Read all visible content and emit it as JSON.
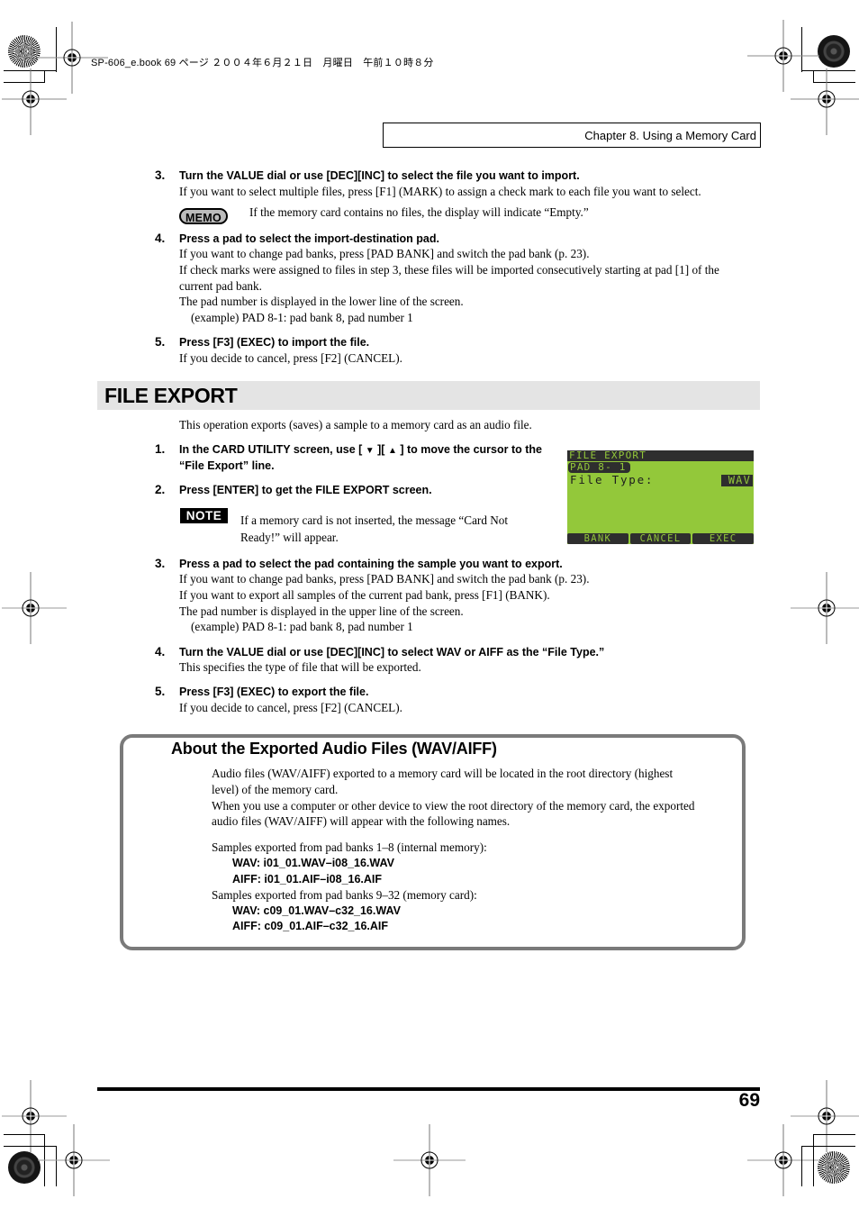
{
  "print_header": {
    "meta_line": "SP-606_e.book  69 ページ  ２００４年６月２１日　月曜日　午前１０時８分"
  },
  "chapter_header": "Chapter 8. Using a Memory Card",
  "import_steps": [
    {
      "number": "3.",
      "title": "Turn the VALUE dial or use [DEC][INC] to select the file you want to import.",
      "lines": [
        "If you want to select multiple files, press [F1] (MARK) to assign a check mark to each file you want to select."
      ],
      "memo": {
        "badge": "MEMO",
        "text": "If the memory card contains no files, the display will indicate “Empty.”"
      }
    },
    {
      "number": "4.",
      "title": "Press a pad to select the import-destination pad.",
      "lines": [
        "If you want to change pad banks, press [PAD BANK] and switch the pad bank (p. 23).",
        "If check marks were assigned to files in step 3, these files will be imported consecutively starting at pad [1] of the",
        "current pad bank.",
        "The pad number is displayed in the lower line of the screen.",
        "(example) PAD 8-1: pad bank 8, pad number 1"
      ]
    },
    {
      "number": "5.",
      "title": "Press [F3] (EXEC) to import the file.",
      "lines": [
        "If you decide to cancel, press [F2] (CANCEL)."
      ]
    }
  ],
  "section": {
    "title": "FILE EXPORT",
    "intro": "This operation exports (saves) a sample to a memory card as an audio file."
  },
  "export_steps": [
    {
      "number": "1.",
      "title_parts": [
        "In the CARD UTILITY screen, use [ ",
        " ][ ",
        " ] to move the cursor to the",
        "“File Export” line."
      ],
      "icons": [
        "down-arrow",
        "up-arrow"
      ]
    },
    {
      "number": "2.",
      "title": "Press [ENTER] to get the FILE EXPORT screen.",
      "note": {
        "badge": "NOTE",
        "lines": [
          "If a memory card is not inserted, the message “Card Not",
          "Ready!” will appear."
        ]
      }
    },
    {
      "number": "3.",
      "title": "Press a pad to select the pad containing the sample you want to export.",
      "lines": [
        "If you want to change pad banks, press [PAD BANK] and switch the pad bank (p. 23).",
        "If you want to export all samples of the current pad bank, press [F1] (BANK).",
        "The pad number is displayed in the upper line of the screen.",
        "(example) PAD 8-1: pad bank 8, pad number 1"
      ]
    },
    {
      "number": "4.",
      "title": "Turn the VALUE dial or use [DEC][INC] to select WAV or AIFF as the “File Type.”",
      "lines": [
        "This specifies the type of file that will be exported."
      ]
    },
    {
      "number": "5.",
      "title": "Press [F3] (EXEC) to export the file.",
      "lines": [
        "If you decide to cancel, press [F2] (CANCEL)."
      ]
    }
  ],
  "lcd_screen": {
    "title": "FILE EXPORT",
    "pad": "PAD 8- 1",
    "field_label": "File Type:",
    "field_value": "WAV",
    "function_keys": [
      "BANK",
      "CANCEL",
      "EXEC"
    ],
    "colors": {
      "background": "#93c83a",
      "inverse": "#2e2e2e"
    }
  },
  "info_box": {
    "title": "About the Exported Audio Files (WAV/AIFF)",
    "paragraph_lines": [
      "Audio files (WAV/AIFF) exported to a memory card will be located in the root directory (highest",
      "level) of the memory card.",
      "When you use a computer or other device to view the root directory of the memory card, the exported",
      "audio files (WAV/AIFF) will appear with the following names."
    ],
    "groups": [
      {
        "label": "Samples exported from pad banks 1–8 (internal memory):",
        "wav": "WAV: i01_01.WAV–i08_16.WAV",
        "aiff": "AIFF: i01_01.AIF–i08_16.AIF"
      },
      {
        "label": "Samples exported from pad banks 9–32 (memory card):",
        "wav": "WAV: c09_01.WAV–c32_16.WAV",
        "aiff": "AIFF: c09_01.AIF–c32_16.AIF"
      }
    ]
  },
  "footer": {
    "page_number": "69"
  }
}
